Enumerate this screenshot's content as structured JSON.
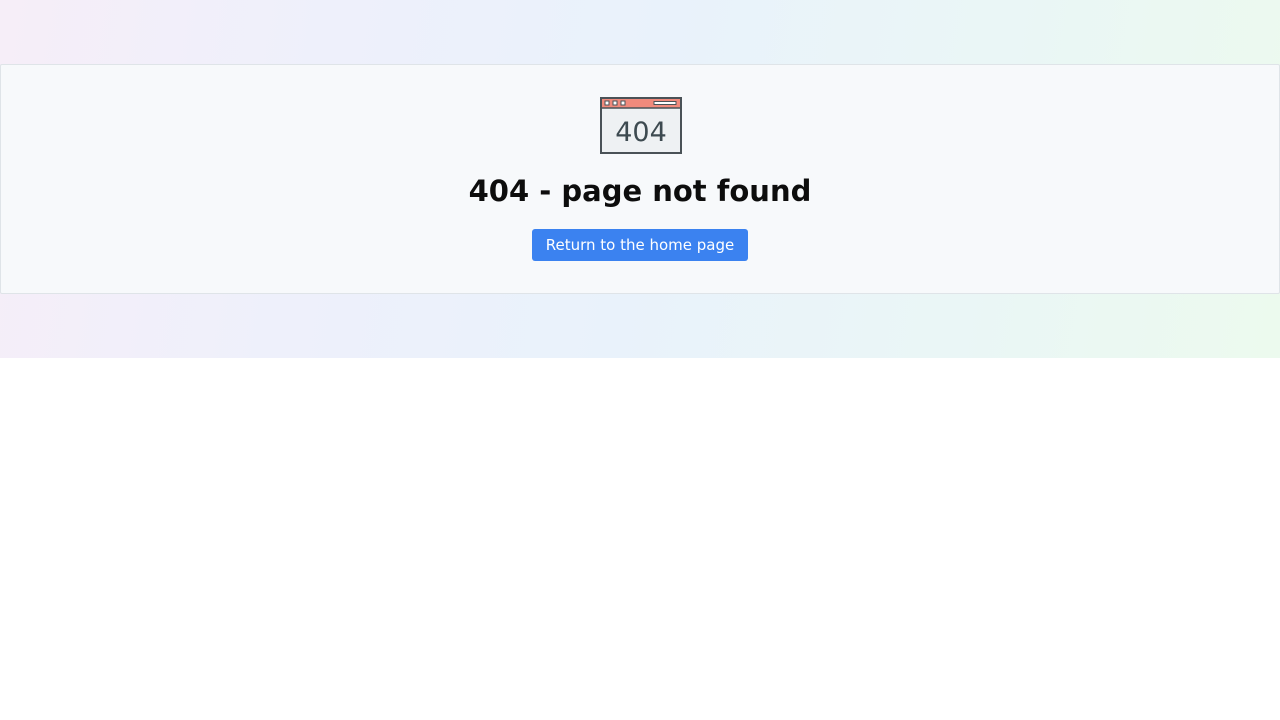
{
  "error": {
    "icon_name": "browser-404-icon",
    "icon_text": "404",
    "title": "404 - page not found",
    "home_button_label": "Return to the home page"
  },
  "colors": {
    "button": "#3b82f0",
    "icon_titlebar": "#f08a7c",
    "icon_frame": "#4a5257"
  }
}
